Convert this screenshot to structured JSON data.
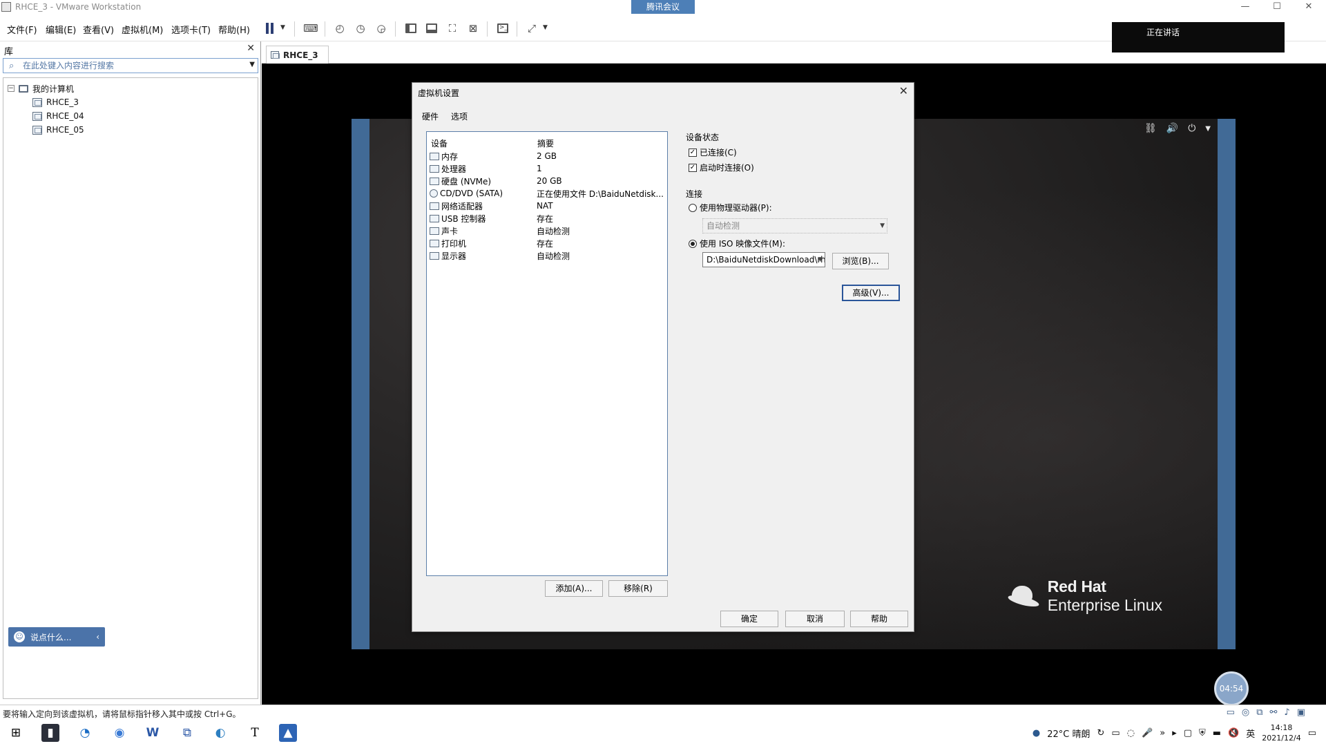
{
  "window": {
    "title": "RHCE_3 - VMware Workstation",
    "meeting_label": "腾讯会议",
    "minimize": "—",
    "maximize": "☐",
    "close": "✕"
  },
  "menu": {
    "items": [
      "文件(F)",
      "编辑(E)",
      "查看(V)",
      "虚拟机(M)",
      "选项卡(T)",
      "帮助(H)"
    ]
  },
  "library": {
    "header": "库",
    "close": "✕",
    "search_placeholder": "在此处键入内容进行搜索",
    "root_label": "我的计算机",
    "root_toggle": "−",
    "vms": [
      "RHCE_3",
      "RHCE_04",
      "RHCE_05"
    ],
    "chat_label": "说点什么...",
    "chat_chevron": "‹"
  },
  "vm_tab": {
    "label": "RHCE_3"
  },
  "guest": {
    "brand_line1": "Red Hat",
    "brand_line2": "Enterprise Linux",
    "timer": "04:54",
    "meeting_status": "正在讲话"
  },
  "dialog": {
    "title": "虚拟机设置",
    "close": "✕",
    "tabs": [
      "硬件",
      "选项"
    ],
    "list_headers": {
      "device": "设备",
      "summary": "摘要"
    },
    "devices": [
      {
        "name": "内存",
        "summary": "2 GB",
        "icon": "memory-icon"
      },
      {
        "name": "处理器",
        "summary": "1",
        "icon": "cpu-icon"
      },
      {
        "name": "硬盘 (NVMe)",
        "summary": "20 GB",
        "icon": "disk-icon"
      },
      {
        "name": "CD/DVD (SATA)",
        "summary": "正在使用文件 D:\\BaiduNetdisk...",
        "icon": "cd-icon"
      },
      {
        "name": "网络适配器",
        "summary": "NAT",
        "icon": "network-icon"
      },
      {
        "name": "USB 控制器",
        "summary": "存在",
        "icon": "usb-icon"
      },
      {
        "name": "声卡",
        "summary": "自动检测",
        "icon": "sound-icon"
      },
      {
        "name": "打印机",
        "summary": "存在",
        "icon": "printer-icon"
      },
      {
        "name": "显示器",
        "summary": "自动检测",
        "icon": "display-icon"
      }
    ],
    "add_button": "添加(A)...",
    "remove_button": "移除(R)",
    "device_status_title": "设备状态",
    "connected": "已连接(C)",
    "connect_at_power_on": "启动时连接(O)",
    "connection_title": "连接",
    "use_physical_drive": "使用物理驱动器(P):",
    "physical_drive_value": "自动检测",
    "use_iso": "使用 ISO 映像文件(M):",
    "iso_path": "D:\\BaiduNetdiskDownload\\rh",
    "browse_button": "浏览(B)...",
    "advanced_button": "高级(V)...",
    "ok_button": "确定",
    "cancel_button": "取消",
    "help_button": "帮助"
  },
  "statusbar": {
    "message": "要将输入定向到该虚拟机，请将鼠标指针移入其中或按 Ctrl+G。"
  },
  "taskbar": {
    "weather": "22°C 晴朗",
    "ime": "英",
    "time": "14:18",
    "date": "2021/12/4"
  }
}
